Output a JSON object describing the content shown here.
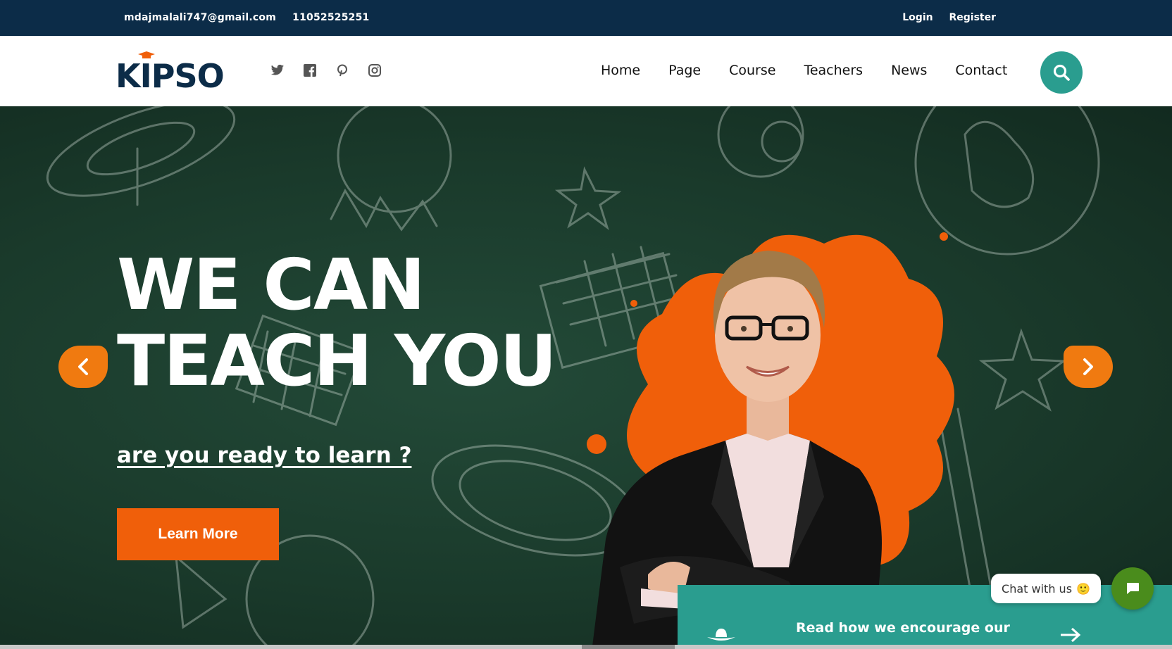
{
  "topbar": {
    "email": "mdajmalali747@gmail.com",
    "phone": "11052525251",
    "login": "Login",
    "register": "Register"
  },
  "header": {
    "logo_text": "KIPSO",
    "socials": [
      "twitter-icon",
      "facebook-icon",
      "pinterest-icon",
      "instagram-icon"
    ],
    "nav": [
      "Home",
      "Page",
      "Course",
      "Teachers",
      "News",
      "Contact"
    ]
  },
  "hero": {
    "title_line1": "WE CAN",
    "title_line2": "TEACH YOU",
    "subtitle": "are you ready to learn ?",
    "cta": "Learn More"
  },
  "info_card": {
    "text": "Read how we encourage our"
  },
  "chat": {
    "label": "Chat with us",
    "emoji": "🙂"
  },
  "colors": {
    "topbar": "#0c2c48",
    "accent_orange": "#f05f0a",
    "teal": "#2a9d8f",
    "chat_green": "#4a8c1c",
    "hero_bg": "#1a3a2b"
  }
}
